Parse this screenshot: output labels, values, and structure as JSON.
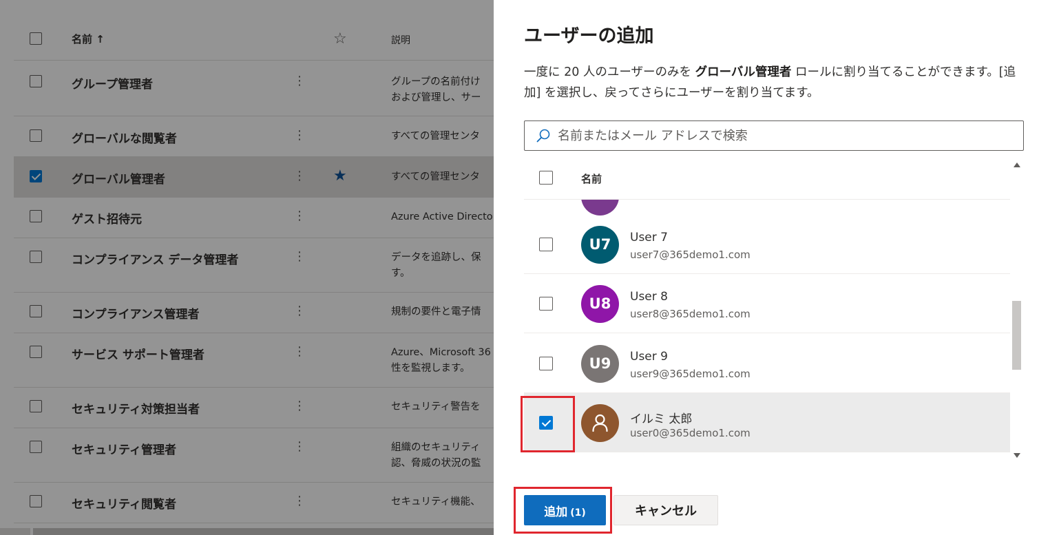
{
  "background_list": {
    "header": {
      "name": "名前 ↑",
      "description": "説明"
    },
    "rows": [
      {
        "name": "グループ管理者",
        "desc": [
          "グループの名前付け",
          "および管理し、サー"
        ],
        "checked": false,
        "starred": false
      },
      {
        "name": "グローバルな閲覧者",
        "desc": [
          "すべての管理センタ"
        ],
        "checked": false,
        "starred": false
      },
      {
        "name": "グローバル管理者",
        "desc": [
          "すべての管理センタ"
        ],
        "checked": true,
        "starred": true
      },
      {
        "name": "ゲスト招待元",
        "desc": [
          "Azure Active Directo"
        ],
        "checked": false,
        "starred": false
      },
      {
        "name": "コンプライアンス データ管理者",
        "desc": [
          "データを追跡し、保",
          "す。"
        ],
        "checked": false,
        "starred": false
      },
      {
        "name": "コンプライアンス管理者",
        "desc": [
          "規制の要件と電子情"
        ],
        "checked": false,
        "starred": false
      },
      {
        "name": "サービス サポート管理者",
        "desc": [
          "Azure、Microsoft 36",
          "性を監視します。"
        ],
        "checked": false,
        "starred": false
      },
      {
        "name": "セキュリティ対策担当者",
        "desc": [
          "セキュリティ警告を"
        ],
        "checked": false,
        "starred": false
      },
      {
        "name": "セキュリティ管理者",
        "desc": [
          "組織のセキュリティ",
          "認、脅威の状況の監"
        ],
        "checked": false,
        "starred": false
      },
      {
        "name": "セキュリティ閲覧者",
        "desc": [
          "セキュリティ機能、"
        ],
        "checked": false,
        "starred": false
      }
    ]
  },
  "panel": {
    "title": "ユーザーの追加",
    "desc_part1": "一度に 20 人のユーザーのみを ",
    "desc_bold": "グローバル管理者",
    "desc_part2": " ロールに割り当てることができます。[追加] を選択し、戻ってさらにユーザーを割り当てます。",
    "search_placeholder": "名前またはメール アドレスで検索",
    "list_header": "名前",
    "users": [
      {
        "initials": "U7",
        "name": "User 7",
        "email": "user7@365demo1.com",
        "color": "#005b70",
        "checked": false
      },
      {
        "initials": "U8",
        "name": "User 8",
        "email": "user8@365demo1.com",
        "color": "#8f16a8",
        "checked": false
      },
      {
        "initials": "U9",
        "name": "User 9",
        "email": "user9@365demo1.com",
        "color": "#7a7574",
        "checked": false
      },
      {
        "initials": "",
        "name": "イルミ 太郎",
        "email": "user0@365demo1.com",
        "color": "#8e562e",
        "checked": true,
        "icon": "person-icon"
      }
    ],
    "add_label": "追加",
    "add_count": "(1)",
    "cancel_label": "キャンセル"
  }
}
